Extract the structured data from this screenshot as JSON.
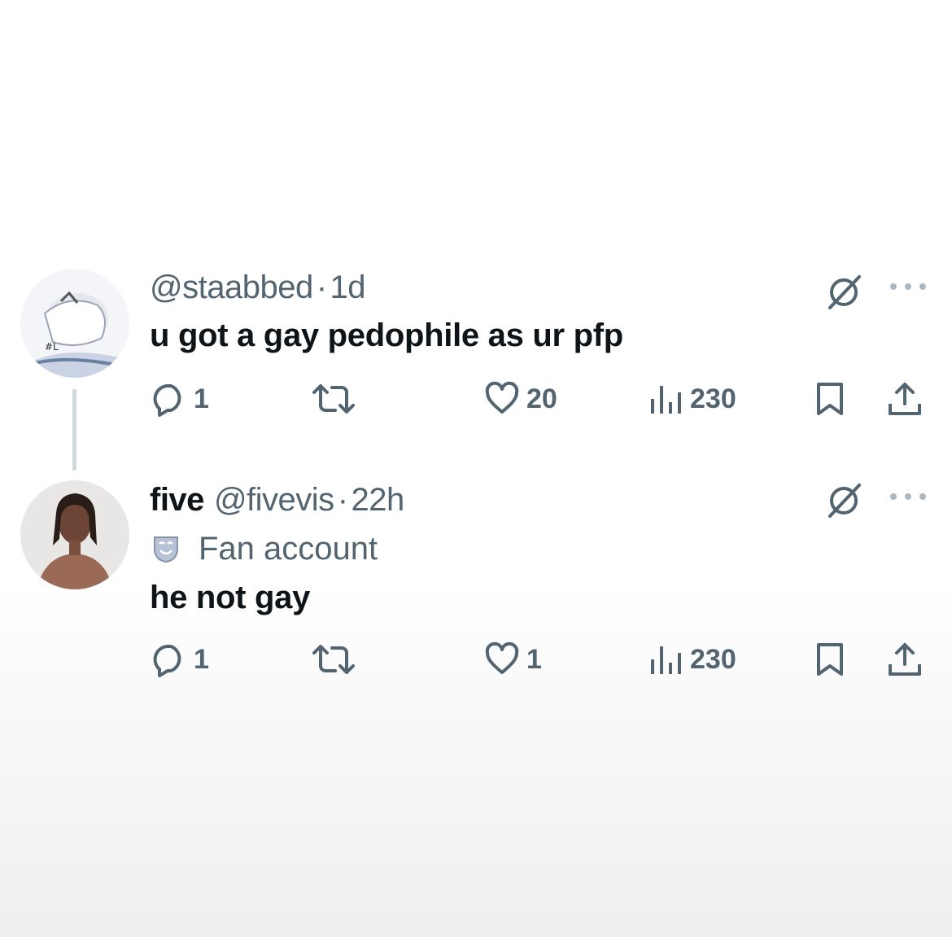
{
  "tweets": [
    {
      "display_name": "",
      "handle": "@staabbed",
      "separator": "·",
      "time": "1d",
      "text": "u got a gay pedophile as ur pfp",
      "replies": "1",
      "reposts": "",
      "likes": "20",
      "views": "230"
    },
    {
      "display_name": "five",
      "handle": "@fivevis",
      "separator": "·",
      "time": "22h",
      "label": "Fan account",
      "text": "he not gay",
      "replies": "1",
      "reposts": "",
      "likes": "1",
      "views": "230"
    }
  ],
  "colors": {
    "text_primary": "#0f1419",
    "text_secondary": "#536471",
    "thread_line": "#cfd9de"
  },
  "icons": [
    "grok-icon",
    "more-icon",
    "reply-icon",
    "repost-icon",
    "like-icon",
    "views-icon",
    "bookmark-icon",
    "share-icon",
    "fan-account-badge-icon"
  ]
}
